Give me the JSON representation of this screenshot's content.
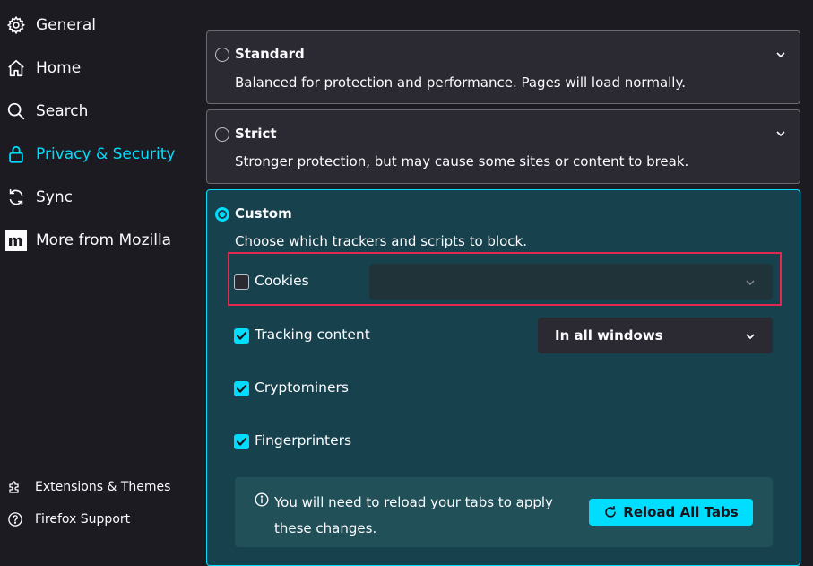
{
  "sidebar": {
    "items": [
      {
        "label": "General",
        "icon": "gear-icon"
      },
      {
        "label": "Home",
        "icon": "home-icon"
      },
      {
        "label": "Search",
        "icon": "search-icon"
      },
      {
        "label": "Privacy & Security",
        "icon": "lock-icon",
        "active": true
      },
      {
        "label": "Sync",
        "icon": "sync-icon"
      },
      {
        "label": "More from Mozilla",
        "icon": "mozilla-m-icon"
      }
    ],
    "footer": [
      {
        "label": "Extensions & Themes",
        "icon": "puzzle-icon"
      },
      {
        "label": "Firefox Support",
        "icon": "help-icon"
      }
    ]
  },
  "protection": {
    "standard": {
      "title": "Standard",
      "description": "Balanced for protection and performance. Pages will load normally.",
      "selected": false
    },
    "strict": {
      "title": "Strict",
      "description": "Stronger protection, but may cause some sites or content to break.",
      "selected": false
    },
    "custom": {
      "title": "Custom",
      "description": "Choose which trackers and scripts to block.",
      "selected": true
    }
  },
  "custom_options": {
    "cookies": {
      "label": "Cookies",
      "checked": false,
      "select_value": ""
    },
    "tracking": {
      "label": "Tracking content",
      "checked": true,
      "select_value": "In all windows"
    },
    "cryptominers": {
      "label": "Cryptominers",
      "checked": true
    },
    "fingerprinters": {
      "label": "Fingerprinters",
      "checked": true
    }
  },
  "notice": {
    "text": "You will need to reload your tabs to apply these changes.",
    "button_label": "Reload All Tabs"
  },
  "colors": {
    "accent": "#00ddff",
    "background": "#1c1b22",
    "card": "#2b2a33",
    "custom_card": "#17414c",
    "highlight": "#e22850"
  }
}
